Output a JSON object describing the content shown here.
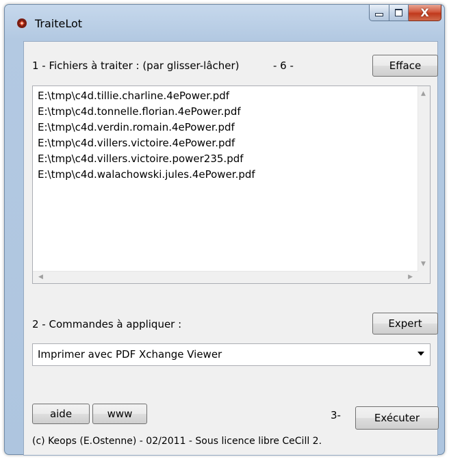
{
  "window": {
    "title": "TraiteLot",
    "close_glyph": "X"
  },
  "files_section": {
    "label": "1 - Fichiers à traiter : (par glisser-lâcher)",
    "count": "- 6 -",
    "clear_button": "Efface",
    "files": [
      "E:\\tmp\\c4d.tillie.charline.4ePower.pdf",
      "E:\\tmp\\c4d.tonnelle.florian.4ePower.pdf",
      "E:\\tmp\\c4d.verdin.romain.4ePower.pdf",
      "E:\\tmp\\c4d.villers.victoire.4ePower.pdf",
      "E:\\tmp\\c4d.villers.victoire.power235.pdf",
      "E:\\tmp\\c4d.walachowski.jules.4ePower.pdf"
    ]
  },
  "commands_section": {
    "label": "2 - Commandes à appliquer :",
    "expert_button": "Expert",
    "selected_command": "Imprimer avec PDF Xchange Viewer"
  },
  "footer": {
    "help_button": "aide",
    "www_button": "www",
    "step_label": "3-",
    "execute_button": "Exécuter",
    "copyright": "(c) Keops (E.Ostenne) - 02/2011 - Sous licence libre CeCill 2."
  },
  "icons": {
    "app": "app-icon",
    "minimize": "minimize-icon",
    "maximize": "maximize-icon",
    "close": "close-icon",
    "dropdown": "chevron-down-icon"
  },
  "colors": {
    "title_bar": "#b9cde5",
    "client_bg": "#f0f0f0",
    "close_button": "#c7452a"
  }
}
